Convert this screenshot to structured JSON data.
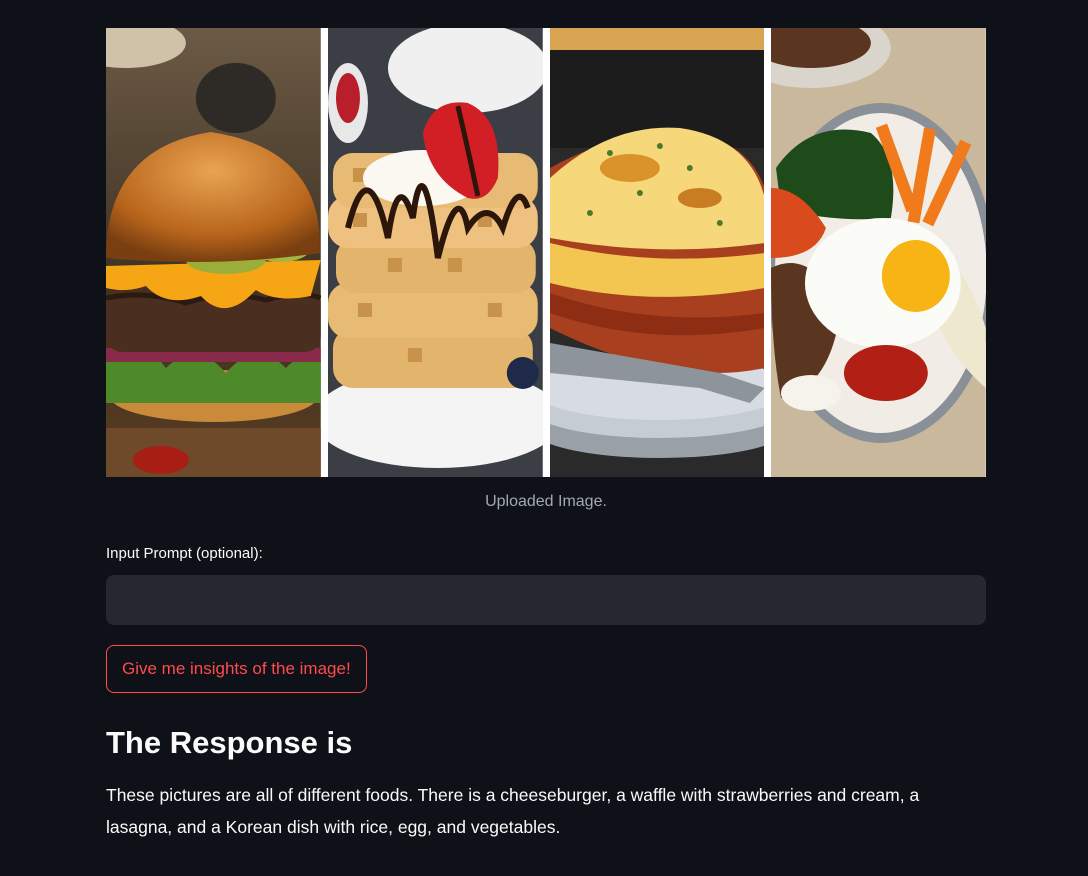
{
  "uploaded_image": {
    "caption": "Uploaded Image.",
    "panels": [
      {
        "subject": "cheeseburger"
      },
      {
        "subject": "waffles with strawberry and cream"
      },
      {
        "subject": "lasagna"
      },
      {
        "subject": "korean rice bowl with egg"
      }
    ]
  },
  "prompt": {
    "label": "Input Prompt (optional):",
    "value": "",
    "placeholder": ""
  },
  "button": {
    "label": "Give me insights of the image!"
  },
  "response": {
    "heading": "The Response is",
    "text": "These pictures are all of different foods. There is a cheeseburger, a waffle with strawberries and cream, a lasagna, and a Korean dish with rice, egg, and vegetables."
  },
  "colors": {
    "background": "#0e1117",
    "accent": "#ff4b4b",
    "input_bg": "#262730",
    "caption": "#a3a8b4"
  }
}
